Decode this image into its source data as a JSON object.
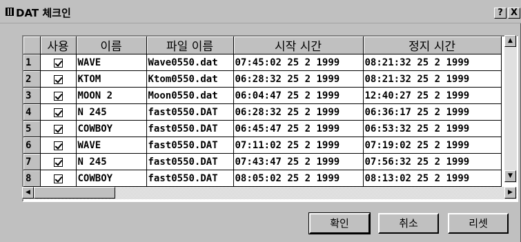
{
  "window": {
    "title": "DAT 체크인"
  },
  "titlebar_buttons": {
    "help": "?",
    "close": "X"
  },
  "columns": [
    "사용",
    "이름",
    "파일 이름",
    "시작 시간",
    "정지 시간"
  ],
  "rows": [
    {
      "num": "1",
      "checked": true,
      "name": "WAVE",
      "file": "Wave0550.dat",
      "start": "07:45:02 25 2 1999",
      "stop": "08:21:32 25 2 1999"
    },
    {
      "num": "2",
      "checked": true,
      "name": "KTOM",
      "file": "Ktom0550.dat",
      "start": "06:28:32 25 2 1999",
      "stop": "08:21:32 25 2 1999"
    },
    {
      "num": "3",
      "checked": true,
      "name": "MOON 2",
      "file": "Moon0550.dat",
      "start": "06:04:47 25 2 1999",
      "stop": "12:40:27 25 2 1999"
    },
    {
      "num": "4",
      "checked": true,
      "name": "N 245",
      "file": "fast0550.DAT",
      "start": "06:28:32 25 2 1999",
      "stop": "06:36:17 25 2 1999"
    },
    {
      "num": "5",
      "checked": true,
      "name": "COWBOY",
      "file": "fast0550.DAT",
      "start": "06:45:47 25 2 1999",
      "stop": "06:53:32 25 2 1999"
    },
    {
      "num": "6",
      "checked": true,
      "name": "WAVE",
      "file": "fast0550.DAT",
      "start": "07:11:02 25 2 1999",
      "stop": "07:19:02 25 2 1999"
    },
    {
      "num": "7",
      "checked": true,
      "name": "N 245",
      "file": "fast0550.DAT",
      "start": "07:43:47 25 2 1999",
      "stop": "07:56:32 25 2 1999"
    },
    {
      "num": "8",
      "checked": true,
      "name": "COWBOY",
      "file": "fast0550.DAT",
      "start": "08:05:02 25 2 1999",
      "stop": "08:13:02 25 2 1999"
    }
  ],
  "buttons": {
    "ok": "확인",
    "cancel": "취소",
    "reset": "리셋"
  }
}
